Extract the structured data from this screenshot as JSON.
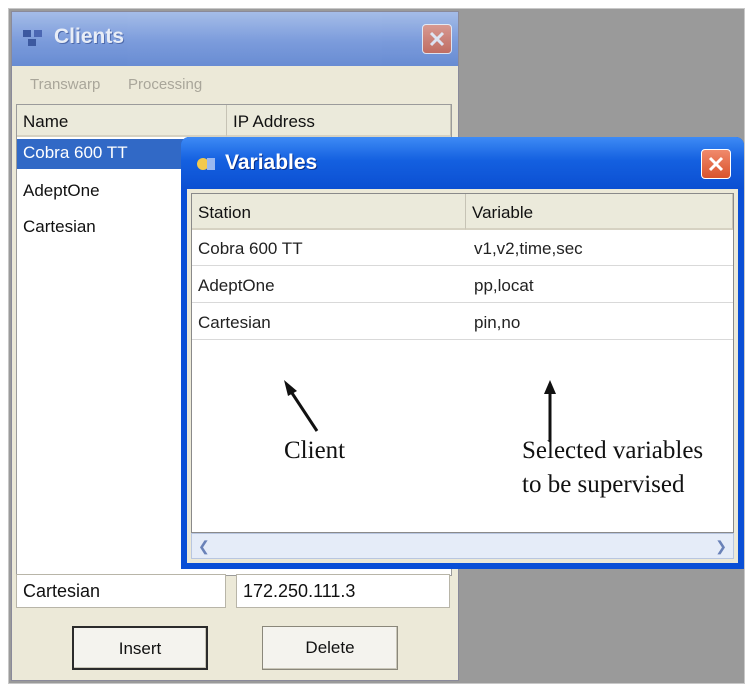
{
  "clients_window": {
    "title": "Clients",
    "menu": [
      "Transwarp",
      "Processing"
    ],
    "columns": [
      "Name",
      "IP Address"
    ],
    "rows": [
      "Cobra 600 TT",
      "AdeptOne",
      "Cartesian"
    ],
    "selected_row": "Cobra 600 TT",
    "name_field_value": "Cartesian",
    "ip_field_value": "172.250.111.3",
    "insert_button": "Insert",
    "delete_button": "Delete"
  },
  "variables_window": {
    "title": "Variables",
    "columns": [
      "Station",
      "Variable"
    ],
    "rows": [
      {
        "station": "Cobra 600 TT",
        "variable": "v1,v2,time,sec"
      },
      {
        "station": "AdeptOne",
        "variable": "pp,locat"
      },
      {
        "station": "Cartesian",
        "variable": "pin,no"
      }
    ]
  },
  "annotations": {
    "client": "Client",
    "selected_line1": "Selected variables",
    "selected_line2": "to be supervised"
  },
  "colors": {
    "xp_blue": "#0b4fd2",
    "selection": "#3169c6",
    "close_red": "#d9532c",
    "window_face": "#ece9d8"
  }
}
